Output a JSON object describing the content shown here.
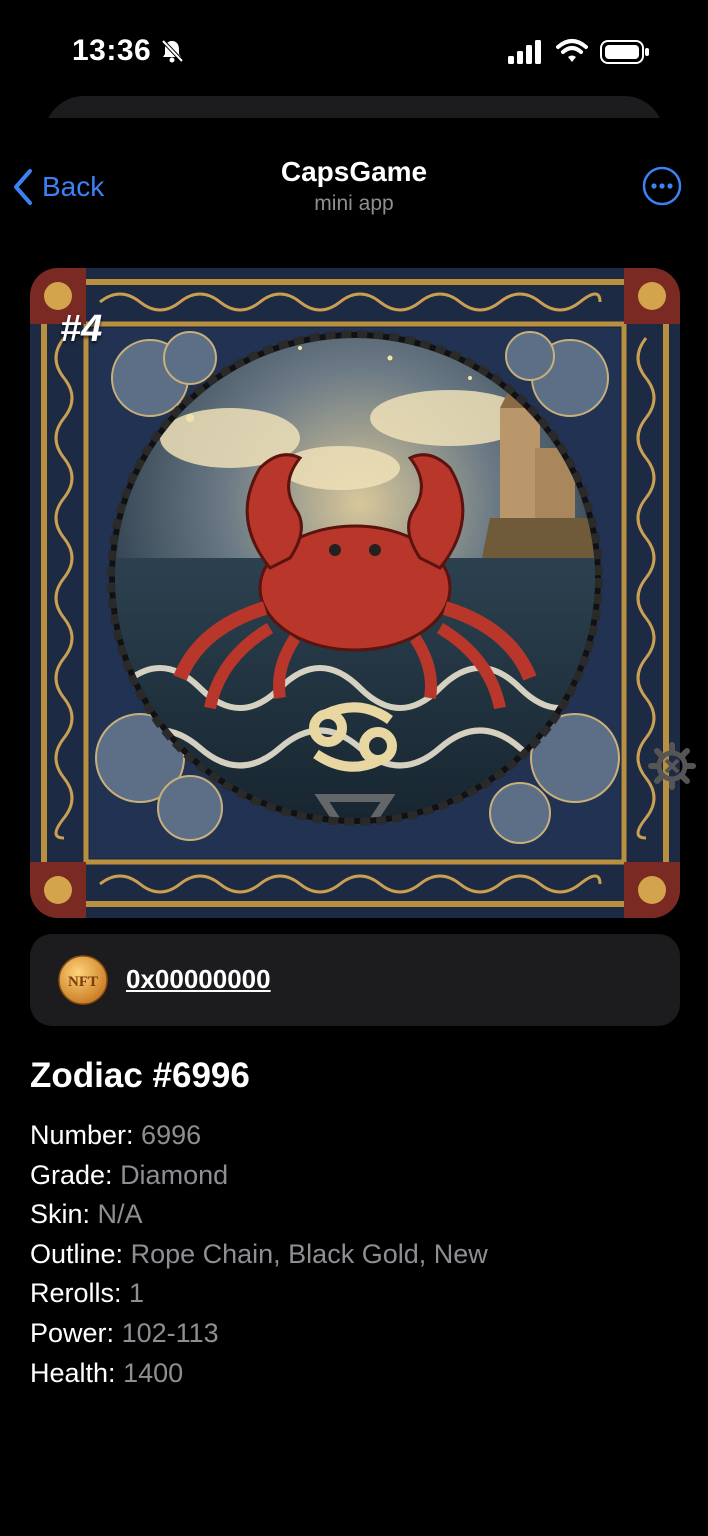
{
  "status_bar": {
    "time": "13:36"
  },
  "header": {
    "back_label": "Back",
    "title": "CapsGame",
    "subtitle": "mini app"
  },
  "card": {
    "badge": "#4",
    "nft_badge_text": "NFT",
    "address": "0x00000000"
  },
  "item": {
    "name": "Zodiac #6996",
    "attributes": [
      {
        "key": "Number:",
        "value": "6996"
      },
      {
        "key": "Grade:",
        "value": "Diamond"
      },
      {
        "key": "Skin:",
        "value": "N/A"
      },
      {
        "key": "Outline:",
        "value": "Rope Chain, Black Gold, New"
      },
      {
        "key": "Rerolls:",
        "value": "1"
      },
      {
        "key": "Power:",
        "value": "102-113"
      },
      {
        "key": "Health:",
        "value": "1400"
      }
    ]
  },
  "colors": {
    "accent": "#3b82f6",
    "secondary_text": "#8e8e93",
    "panel": "#1c1c1e"
  }
}
